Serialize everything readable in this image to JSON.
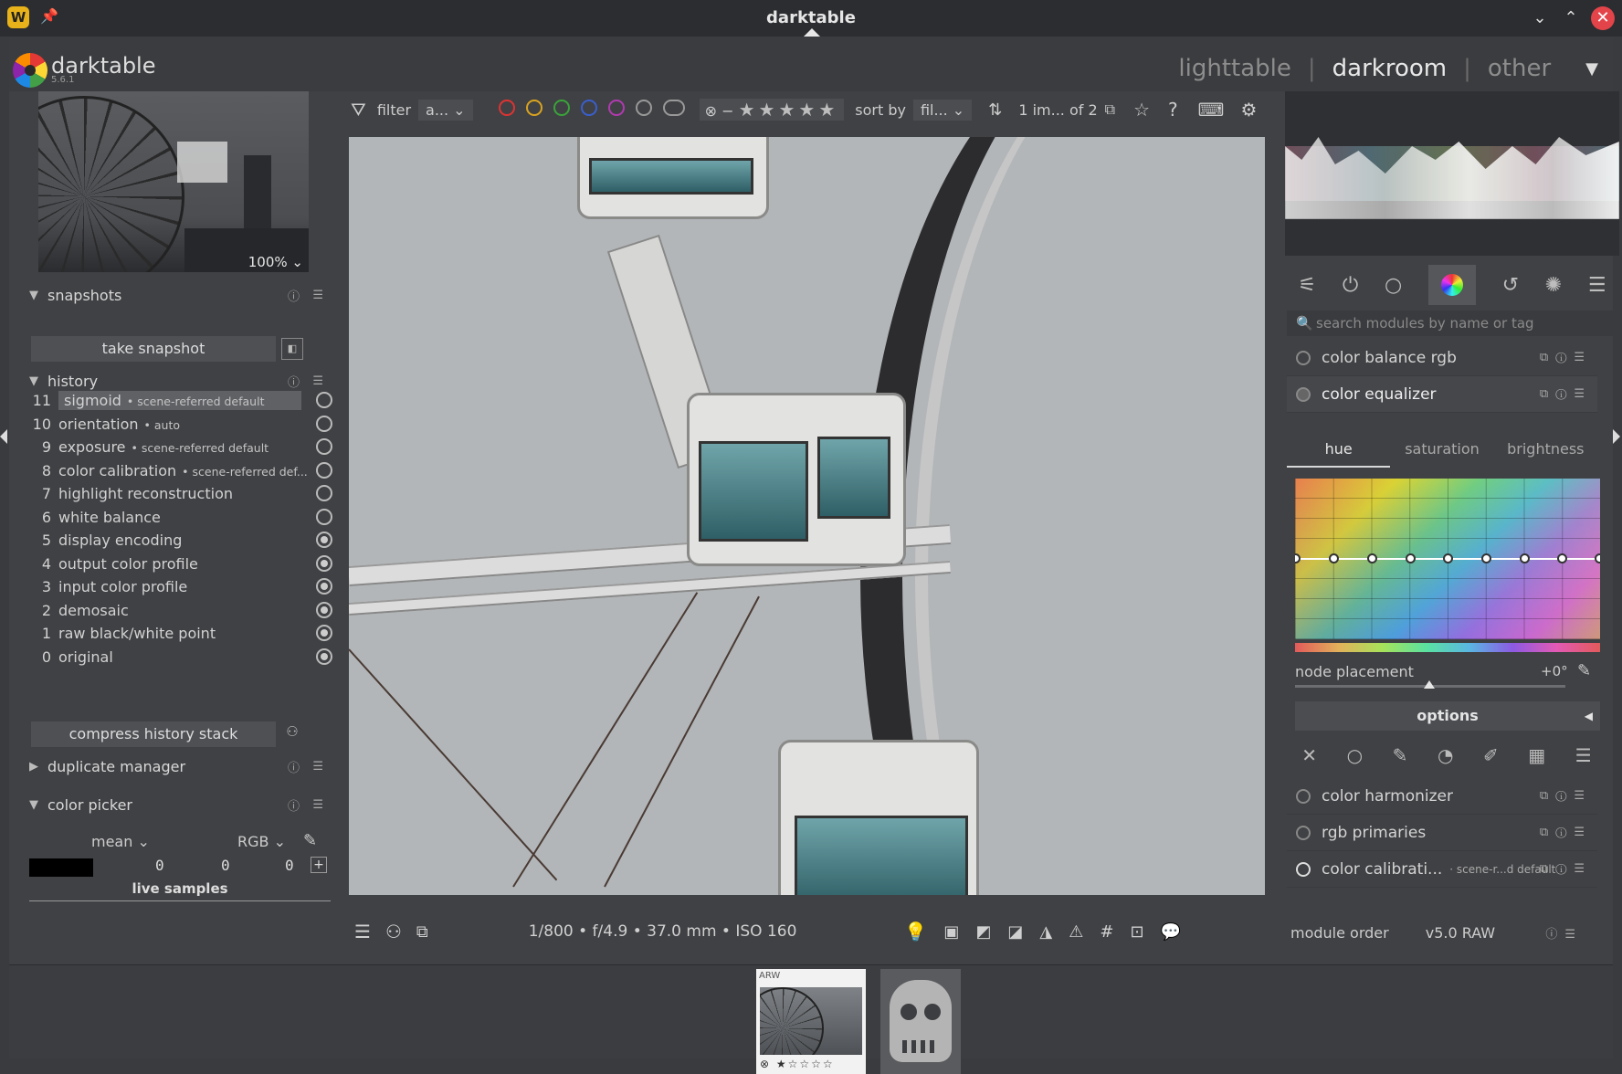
{
  "window": {
    "title": "darktable"
  },
  "app": {
    "name": "darktable",
    "version": "5.6.1"
  },
  "views": {
    "items": [
      "lighttable",
      "darkroom",
      "other"
    ],
    "active": "darkroom"
  },
  "navigation": {
    "zoom": "100%"
  },
  "left": {
    "snapshots": {
      "title": "snapshots",
      "button": "take snapshot"
    },
    "history": {
      "title": "history",
      "items": [
        {
          "n": "11",
          "label": "sigmoid",
          "sub": "• scene-referred default"
        },
        {
          "n": "10",
          "label": "orientation",
          "sub": "• auto"
        },
        {
          "n": "9",
          "label": "exposure",
          "sub": "• scene-referred default"
        },
        {
          "n": "8",
          "label": "color calibration",
          "sub": "• scene-referred def..."
        },
        {
          "n": "7",
          "label": "highlight reconstruction",
          "sub": ""
        },
        {
          "n": "6",
          "label": "white balance",
          "sub": ""
        },
        {
          "n": "5",
          "label": "display encoding",
          "sub": ""
        },
        {
          "n": "4",
          "label": "output color profile",
          "sub": ""
        },
        {
          "n": "3",
          "label": "input color profile",
          "sub": ""
        },
        {
          "n": "2",
          "label": "demosaic",
          "sub": ""
        },
        {
          "n": "1",
          "label": "raw black/white point",
          "sub": ""
        },
        {
          "n": "0",
          "label": "original",
          "sub": ""
        }
      ],
      "compress_button": "compress history stack"
    },
    "duplicate_manager": {
      "title": "duplicate manager"
    },
    "color_picker": {
      "title": "color picker",
      "stat": "mean",
      "model": "RGB",
      "values": [
        "0",
        "0",
        "0"
      ],
      "live_samples": "live samples"
    }
  },
  "toolbar": {
    "filter_label": "filter",
    "filter_value": "a...",
    "sort_label": "sort by",
    "sort_value": "fil...",
    "count": "1 im... of 2"
  },
  "info": {
    "exif": "1/800 • f/4.9 • 37.0 mm • ISO 160"
  },
  "right": {
    "search_placeholder": "search modules by name or tag",
    "modules": {
      "color_balance_rgb": "color balance rgb",
      "color_equalizer": "color equalizer",
      "color_harmonizer": "color harmonizer",
      "rgb_primaries": "rgb primaries",
      "color_calibration": "color calibrati...",
      "color_calibration_sub": "· scene-r...d default"
    },
    "eq_tabs": [
      "hue",
      "saturation",
      "brightness"
    ],
    "node_placement": {
      "label": "node placement",
      "value": "+0°"
    },
    "options": "options",
    "footer": {
      "module_order": "module order",
      "order_value": "v5.0 RAW"
    }
  },
  "filmstrip": {
    "tag": "ARW",
    "stars": "⊗ ★☆☆☆☆"
  }
}
